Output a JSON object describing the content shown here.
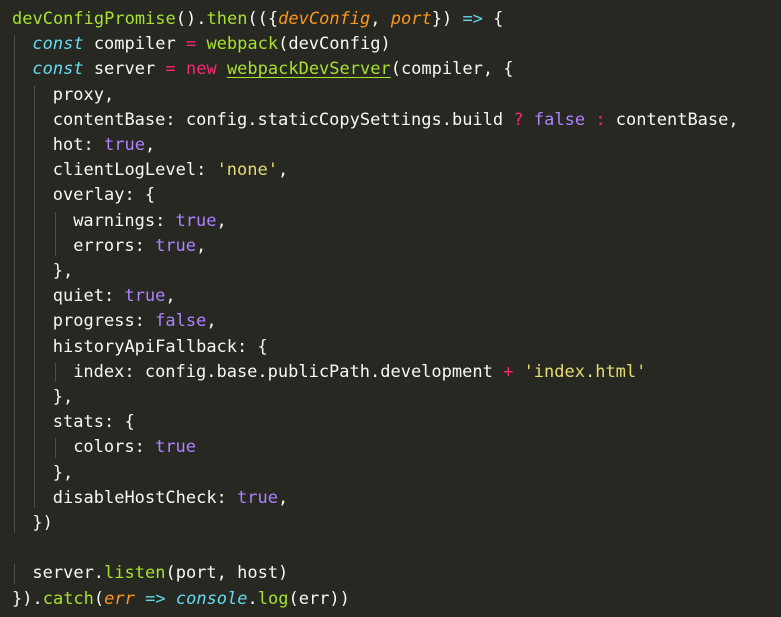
{
  "colors": {
    "background": "#272822",
    "plain": "#f8f8f2",
    "keyword": "#f92672",
    "function": "#a6e22e",
    "storage": "#66d9ef",
    "string": "#e6db74",
    "constant": "#ae81ff",
    "parameter": "#fd971f"
  },
  "code_lines": [
    {
      "indent": 0,
      "tokens": [
        {
          "t": "devConfigPromise",
          "c": "function"
        },
        {
          "t": "().",
          "c": "plain"
        },
        {
          "t": "then",
          "c": "function"
        },
        {
          "t": "(({",
          "c": "plain"
        },
        {
          "t": "devConfig",
          "c": "parameter",
          "i": true
        },
        {
          "t": ", ",
          "c": "plain"
        },
        {
          "t": "port",
          "c": "parameter",
          "i": true
        },
        {
          "t": "}) ",
          "c": "plain"
        },
        {
          "t": "=>",
          "c": "storage"
        },
        {
          "t": " {",
          "c": "plain"
        }
      ]
    },
    {
      "indent": 1,
      "tokens": [
        {
          "t": "const",
          "c": "storage",
          "i": true
        },
        {
          "t": " compiler ",
          "c": "plain"
        },
        {
          "t": "=",
          "c": "keyword"
        },
        {
          "t": " ",
          "c": "plain"
        },
        {
          "t": "webpack",
          "c": "function"
        },
        {
          "t": "(devConfig)",
          "c": "plain"
        }
      ]
    },
    {
      "indent": 1,
      "tokens": [
        {
          "t": "const",
          "c": "storage",
          "i": true
        },
        {
          "t": " server ",
          "c": "plain"
        },
        {
          "t": "=",
          "c": "keyword"
        },
        {
          "t": " ",
          "c": "plain"
        },
        {
          "t": "new",
          "c": "keyword"
        },
        {
          "t": " ",
          "c": "plain"
        },
        {
          "t": "webpackDevServer",
          "c": "function",
          "u": true
        },
        {
          "t": "(compiler, {",
          "c": "plain"
        }
      ]
    },
    {
      "indent": 2,
      "tokens": [
        {
          "t": "proxy,",
          "c": "plain"
        }
      ]
    },
    {
      "indent": 2,
      "tokens": [
        {
          "t": "contentBase: config.staticCopySettings.build ",
          "c": "plain"
        },
        {
          "t": "?",
          "c": "keyword"
        },
        {
          "t": " ",
          "c": "plain"
        },
        {
          "t": "false",
          "c": "constant"
        },
        {
          "t": " ",
          "c": "plain"
        },
        {
          "t": ":",
          "c": "keyword"
        },
        {
          "t": " contentBase,",
          "c": "plain"
        }
      ]
    },
    {
      "indent": 2,
      "tokens": [
        {
          "t": "hot: ",
          "c": "plain"
        },
        {
          "t": "true",
          "c": "constant"
        },
        {
          "t": ",",
          "c": "plain"
        }
      ]
    },
    {
      "indent": 2,
      "tokens": [
        {
          "t": "clientLogLevel: ",
          "c": "plain"
        },
        {
          "t": "'none'",
          "c": "string"
        },
        {
          "t": ",",
          "c": "plain"
        }
      ]
    },
    {
      "indent": 2,
      "tokens": [
        {
          "t": "overlay: {",
          "c": "plain"
        }
      ]
    },
    {
      "indent": 3,
      "tokens": [
        {
          "t": "warnings: ",
          "c": "plain"
        },
        {
          "t": "true",
          "c": "constant"
        },
        {
          "t": ",",
          "c": "plain"
        }
      ]
    },
    {
      "indent": 3,
      "tokens": [
        {
          "t": "errors: ",
          "c": "plain"
        },
        {
          "t": "true",
          "c": "constant"
        },
        {
          "t": ",",
          "c": "plain"
        }
      ]
    },
    {
      "indent": 2,
      "tokens": [
        {
          "t": "},",
          "c": "plain"
        }
      ]
    },
    {
      "indent": 2,
      "tokens": [
        {
          "t": "quiet: ",
          "c": "plain"
        },
        {
          "t": "true",
          "c": "constant"
        },
        {
          "t": ",",
          "c": "plain"
        }
      ]
    },
    {
      "indent": 2,
      "tokens": [
        {
          "t": "progress: ",
          "c": "plain"
        },
        {
          "t": "false",
          "c": "constant"
        },
        {
          "t": ",",
          "c": "plain"
        }
      ]
    },
    {
      "indent": 2,
      "tokens": [
        {
          "t": "historyApiFallback: {",
          "c": "plain"
        }
      ]
    },
    {
      "indent": 3,
      "tokens": [
        {
          "t": "index: config.base.publicPath.development ",
          "c": "plain"
        },
        {
          "t": "+",
          "c": "keyword"
        },
        {
          "t": " ",
          "c": "plain"
        },
        {
          "t": "'index.html'",
          "c": "string"
        }
      ]
    },
    {
      "indent": 2,
      "tokens": [
        {
          "t": "},",
          "c": "plain"
        }
      ]
    },
    {
      "indent": 2,
      "tokens": [
        {
          "t": "stats: {",
          "c": "plain"
        }
      ]
    },
    {
      "indent": 3,
      "tokens": [
        {
          "t": "colors: ",
          "c": "plain"
        },
        {
          "t": "true",
          "c": "constant"
        }
      ]
    },
    {
      "indent": 2,
      "tokens": [
        {
          "t": "},",
          "c": "plain"
        }
      ]
    },
    {
      "indent": 2,
      "tokens": [
        {
          "t": "disableHostCheck: ",
          "c": "plain"
        },
        {
          "t": "true",
          "c": "constant"
        },
        {
          "t": ",",
          "c": "plain"
        }
      ]
    },
    {
      "indent": 1,
      "tokens": [
        {
          "t": "})",
          "c": "plain"
        }
      ]
    },
    {
      "indent": 0,
      "tokens": []
    },
    {
      "indent": 1,
      "tokens": [
        {
          "t": "server.",
          "c": "plain"
        },
        {
          "t": "listen",
          "c": "function"
        },
        {
          "t": "(port, host)",
          "c": "plain"
        }
      ]
    },
    {
      "indent": 0,
      "tokens": [
        {
          "t": "}).",
          "c": "plain"
        },
        {
          "t": "catch",
          "c": "function"
        },
        {
          "t": "(",
          "c": "plain"
        },
        {
          "t": "err",
          "c": "parameter",
          "i": true
        },
        {
          "t": " ",
          "c": "plain"
        },
        {
          "t": "=>",
          "c": "storage"
        },
        {
          "t": " ",
          "c": "plain"
        },
        {
          "t": "console",
          "c": "storage",
          "i": true
        },
        {
          "t": ".",
          "c": "plain"
        },
        {
          "t": "log",
          "c": "function"
        },
        {
          "t": "(err))",
          "c": "plain"
        }
      ]
    }
  ]
}
